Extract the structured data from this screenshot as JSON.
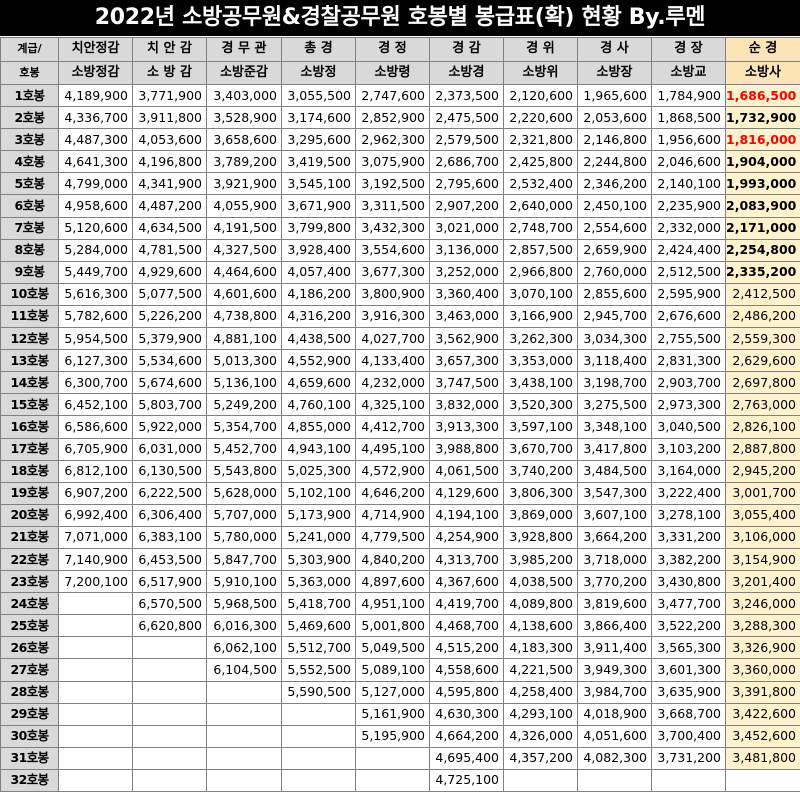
{
  "title": "2022년 소방공무원&경찰공무원 호봉별 봉급표(확) 현황 By.루멘",
  "corner": {
    "top": "계급/",
    "bottom": "호봉"
  },
  "columns": [
    {
      "police": "치안정감",
      "fire": "소방정감"
    },
    {
      "police": "치 안 감",
      "fire": "소 방 감"
    },
    {
      "police": "경 무 관",
      "fire": "소방준감"
    },
    {
      "police": "총 경",
      "fire": "소방정"
    },
    {
      "police": "경 정",
      "fire": "소방령"
    },
    {
      "police": "경 감",
      "fire": "소방경"
    },
    {
      "police": "경 위",
      "fire": "소방위"
    },
    {
      "police": "경 사",
      "fire": "소방장"
    },
    {
      "police": "경 장",
      "fire": "소방교"
    },
    {
      "police": "순 경",
      "fire": "소방사"
    }
  ],
  "highlight": {
    "last_column_bg": "#fff2cc",
    "red_text": "#ff0000"
  },
  "rows": [
    {
      "step": "1호봉",
      "values": [
        "4,189,900",
        "3,771,900",
        "3,403,000",
        "3,055,500",
        "2,747,600",
        "2,373,500",
        "2,120,600",
        "1,965,600",
        "1,784,900",
        "1,686,500"
      ],
      "last_style": "red-bold"
    },
    {
      "step": "2호봉",
      "values": [
        "4,336,700",
        "3,911,800",
        "3,528,900",
        "3,174,600",
        "2,852,900",
        "2,475,500",
        "2,220,600",
        "2,053,600",
        "1,868,500",
        "1,732,900"
      ],
      "last_style": "bold"
    },
    {
      "step": "3호봉",
      "values": [
        "4,487,300",
        "4,053,600",
        "3,658,600",
        "3,295,600",
        "2,962,300",
        "2,579,500",
        "2,321,800",
        "2,146,800",
        "1,956,600",
        "1,816,000"
      ],
      "last_style": "red-bold"
    },
    {
      "step": "4호봉",
      "values": [
        "4,641,300",
        "4,196,800",
        "3,789,200",
        "3,419,500",
        "3,075,900",
        "2,686,700",
        "2,425,800",
        "2,244,800",
        "2,046,600",
        "1,904,000"
      ],
      "last_style": "bold"
    },
    {
      "step": "5호봉",
      "values": [
        "4,799,000",
        "4,341,900",
        "3,921,900",
        "3,545,100",
        "3,192,500",
        "2,795,600",
        "2,532,400",
        "2,346,200",
        "2,140,100",
        "1,993,000"
      ],
      "last_style": "bold"
    },
    {
      "step": "6호봉",
      "values": [
        "4,958,600",
        "4,487,200",
        "4,055,900",
        "3,671,900",
        "3,311,500",
        "2,907,200",
        "2,640,000",
        "2,450,100",
        "2,235,900",
        "2,083,900"
      ],
      "last_style": "bold"
    },
    {
      "step": "7호봉",
      "values": [
        "5,120,600",
        "4,634,500",
        "4,191,500",
        "3,799,800",
        "3,432,300",
        "3,021,000",
        "2,748,700",
        "2,554,600",
        "2,332,000",
        "2,171,000"
      ],
      "last_style": "bold"
    },
    {
      "step": "8호봉",
      "values": [
        "5,284,000",
        "4,781,500",
        "4,327,500",
        "3,928,400",
        "3,554,600",
        "3,136,000",
        "2,857,500",
        "2,659,900",
        "2,424,400",
        "2,254,800"
      ],
      "last_style": "bold"
    },
    {
      "step": "9호봉",
      "values": [
        "5,449,700",
        "4,929,600",
        "4,464,600",
        "4,057,400",
        "3,677,300",
        "3,252,000",
        "2,966,800",
        "2,760,000",
        "2,512,500",
        "2,335,200"
      ],
      "last_style": "bold"
    },
    {
      "step": "10호봉",
      "values": [
        "5,616,300",
        "5,077,500",
        "4,601,600",
        "4,186,200",
        "3,800,900",
        "3,360,400",
        "3,070,100",
        "2,855,600",
        "2,595,900",
        "2,412,500"
      ],
      "last_style": ""
    },
    {
      "step": "11호봉",
      "values": [
        "5,782,600",
        "5,226,200",
        "4,738,800",
        "4,316,200",
        "3,916,300",
        "3,463,000",
        "3,166,900",
        "2,945,700",
        "2,676,600",
        "2,486,200"
      ],
      "last_style": ""
    },
    {
      "step": "12호봉",
      "values": [
        "5,954,500",
        "5,379,900",
        "4,881,100",
        "4,438,500",
        "4,027,700",
        "3,562,900",
        "3,262,300",
        "3,034,300",
        "2,755,500",
        "2,559,300"
      ],
      "last_style": ""
    },
    {
      "step": "13호봉",
      "values": [
        "6,127,300",
        "5,534,600",
        "5,013,300",
        "4,552,900",
        "4,133,400",
        "3,657,300",
        "3,353,000",
        "3,118,400",
        "2,831,300",
        "2,629,600"
      ],
      "last_style": ""
    },
    {
      "step": "14호봉",
      "values": [
        "6,300,700",
        "5,674,600",
        "5,136,100",
        "4,659,600",
        "4,232,000",
        "3,747,500",
        "3,438,100",
        "3,198,700",
        "2,903,700",
        "2,697,800"
      ],
      "last_style": ""
    },
    {
      "step": "15호봉",
      "values": [
        "6,452,100",
        "5,803,700",
        "5,249,200",
        "4,760,100",
        "4,325,100",
        "3,832,000",
        "3,520,300",
        "3,275,500",
        "2,973,300",
        "2,763,000"
      ],
      "last_style": ""
    },
    {
      "step": "16호봉",
      "values": [
        "6,586,600",
        "5,922,000",
        "5,354,700",
        "4,855,000",
        "4,412,700",
        "3,913,300",
        "3,597,100",
        "3,348,100",
        "3,040,500",
        "2,826,100"
      ],
      "last_style": ""
    },
    {
      "step": "17호봉",
      "values": [
        "6,705,900",
        "6,031,000",
        "5,452,700",
        "4,943,100",
        "4,495,100",
        "3,988,800",
        "3,670,700",
        "3,417,800",
        "3,103,200",
        "2,887,800"
      ],
      "last_style": ""
    },
    {
      "step": "18호봉",
      "values": [
        "6,812,100",
        "6,130,500",
        "5,543,800",
        "5,025,300",
        "4,572,900",
        "4,061,500",
        "3,740,200",
        "3,484,500",
        "3,164,000",
        "2,945,200"
      ],
      "last_style": ""
    },
    {
      "step": "19호봉",
      "values": [
        "6,907,200",
        "6,222,500",
        "5,628,000",
        "5,102,100",
        "4,646,200",
        "4,129,600",
        "3,806,300",
        "3,547,300",
        "3,222,400",
        "3,001,700"
      ],
      "last_style": ""
    },
    {
      "step": "20호봉",
      "values": [
        "6,992,400",
        "6,306,400",
        "5,707,000",
        "5,173,900",
        "4,714,900",
        "4,194,100",
        "3,869,000",
        "3,607,100",
        "3,278,100",
        "3,055,400"
      ],
      "last_style": ""
    },
    {
      "step": "21호봉",
      "values": [
        "7,071,000",
        "6,383,100",
        "5,780,000",
        "5,241,000",
        "4,779,500",
        "4,254,900",
        "3,928,800",
        "3,664,200",
        "3,331,200",
        "3,106,000"
      ],
      "last_style": ""
    },
    {
      "step": "22호봉",
      "values": [
        "7,140,900",
        "6,453,500",
        "5,847,700",
        "5,303,900",
        "4,840,200",
        "4,313,700",
        "3,985,200",
        "3,718,000",
        "3,382,200",
        "3,154,900"
      ],
      "last_style": ""
    },
    {
      "step": "23호봉",
      "values": [
        "7,200,100",
        "6,517,900",
        "5,910,100",
        "5,363,000",
        "4,897,600",
        "4,367,600",
        "4,038,500",
        "3,770,200",
        "3,430,800",
        "3,201,400"
      ],
      "last_style": ""
    },
    {
      "step": "24호봉",
      "values": [
        "",
        "6,570,500",
        "5,968,500",
        "5,418,700",
        "4,951,100",
        "4,419,700",
        "4,089,800",
        "3,819,600",
        "3,477,700",
        "3,246,000"
      ],
      "last_style": ""
    },
    {
      "step": "25호봉",
      "values": [
        "",
        "6,620,800",
        "6,016,300",
        "5,469,600",
        "5,001,800",
        "4,468,700",
        "4,138,600",
        "3,866,400",
        "3,522,200",
        "3,288,300"
      ],
      "last_style": ""
    },
    {
      "step": "26호봉",
      "values": [
        "",
        "",
        "6,062,100",
        "5,512,700",
        "5,049,500",
        "4,515,200",
        "4,183,300",
        "3,911,400",
        "3,565,300",
        "3,326,900"
      ],
      "last_style": ""
    },
    {
      "step": "27호봉",
      "values": [
        "",
        "",
        "6,104,500",
        "5,552,500",
        "5,089,100",
        "4,558,600",
        "4,221,500",
        "3,949,300",
        "3,601,300",
        "3,360,000"
      ],
      "last_style": ""
    },
    {
      "step": "28호봉",
      "values": [
        "",
        "",
        "",
        "5,590,500",
        "5,127,000",
        "4,595,800",
        "4,258,400",
        "3,984,700",
        "3,635,900",
        "3,391,800"
      ],
      "last_style": ""
    },
    {
      "step": "29호봉",
      "values": [
        "",
        "",
        "",
        "",
        "5,161,900",
        "4,630,300",
        "4,293,100",
        "4,018,900",
        "3,668,700",
        "3,422,600"
      ],
      "last_style": ""
    },
    {
      "step": "30호봉",
      "values": [
        "",
        "",
        "",
        "",
        "5,195,900",
        "4,664,200",
        "4,326,000",
        "4,051,600",
        "3,700,400",
        "3,452,600"
      ],
      "last_style": ""
    },
    {
      "step": "31호봉",
      "values": [
        "",
        "",
        "",
        "",
        "",
        "4,695,400",
        "4,357,200",
        "4,082,300",
        "3,731,200",
        "3,481,800"
      ],
      "last_style": ""
    },
    {
      "step": "32호봉",
      "values": [
        "",
        "",
        "",
        "",
        "",
        "4,725,100",
        "",
        "",
        "",
        ""
      ],
      "last_style": ""
    }
  ]
}
